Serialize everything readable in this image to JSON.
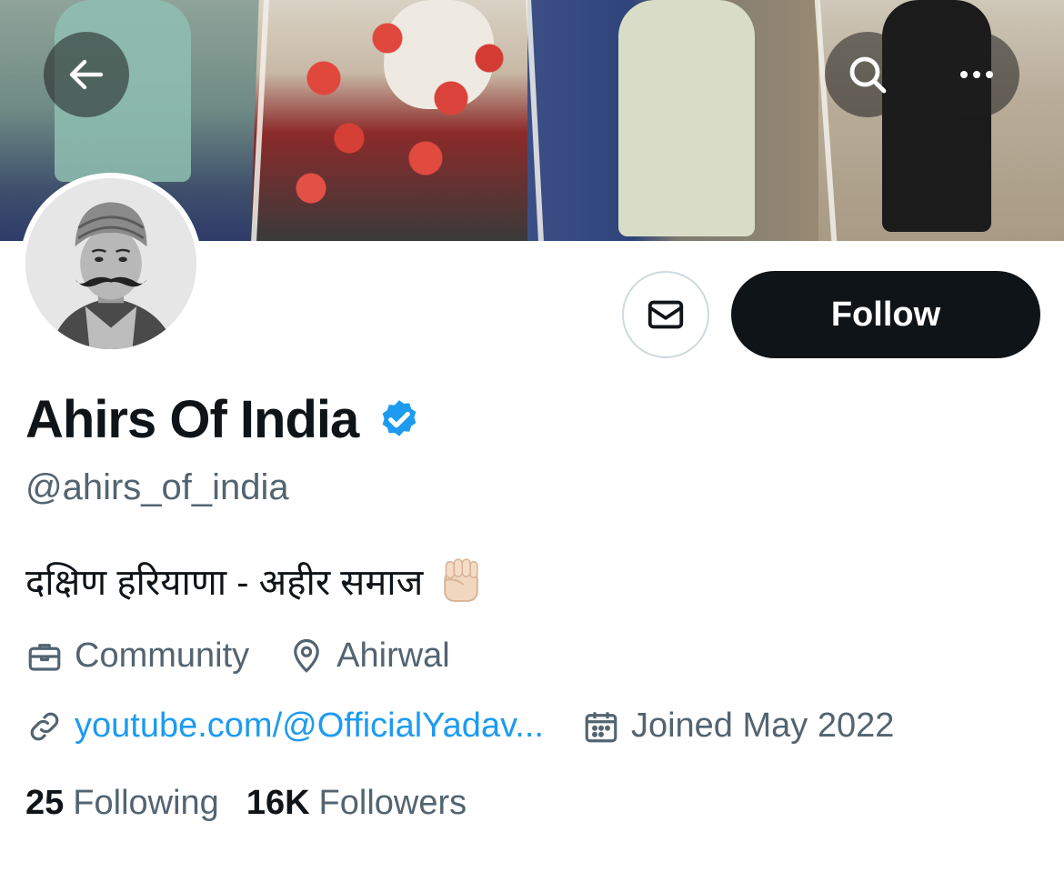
{
  "header": {
    "back_icon": "arrow-left-icon",
    "search_icon": "search-icon",
    "more_icon": "more-horizontal-icon"
  },
  "profile": {
    "display_name": "Ahirs Of India",
    "verified_icon": "verified-badge-icon",
    "verified_color": "#1d9bf0",
    "handle": "@ahirs_of_india",
    "bio": "दक्षिण हरियाणा - अहीर समाज",
    "bio_emoji": "raised-fist-emoji",
    "category": "Community",
    "location": "Ahirwal",
    "website": "youtube.com/@OfficialYadav...",
    "joined": "Joined May 2022"
  },
  "actions": {
    "message_icon": "envelope-icon",
    "follow_label": "Follow"
  },
  "stats": {
    "following_count": "25",
    "following_label": "Following",
    "followers_count": "16K",
    "followers_label": "Followers"
  },
  "colors": {
    "text_primary": "#0f1419",
    "text_secondary": "#536471",
    "link": "#1d9bf0",
    "follow_bg": "#0f1419"
  }
}
